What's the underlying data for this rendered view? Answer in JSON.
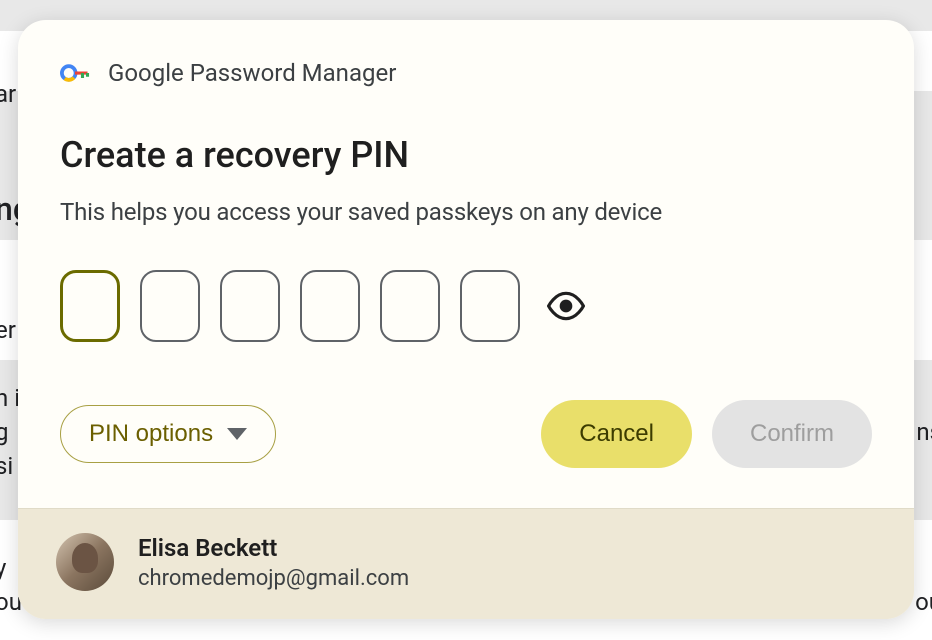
{
  "header": {
    "app_name": "Google Password Manager"
  },
  "main": {
    "title": "Create a recovery PIN",
    "subtitle": "This helps you access your saved passkeys on any device"
  },
  "pin": {
    "length": 6,
    "focused_index": 0
  },
  "actions": {
    "pin_options_label": "PIN options",
    "cancel_label": "Cancel",
    "confirm_label": "Confirm",
    "confirm_enabled": false
  },
  "user": {
    "name": "Elisa Beckett",
    "email": "chromedemojp@gmail.com"
  },
  "bg_fragments": {
    "t1": "ar",
    "t2": "ng",
    "t3": "er",
    "t4": "n i",
    "t5": "g",
    "t6": "si",
    "t7": "y",
    "t8": "ou",
    "r1": "ns",
    "r2": "ou"
  }
}
